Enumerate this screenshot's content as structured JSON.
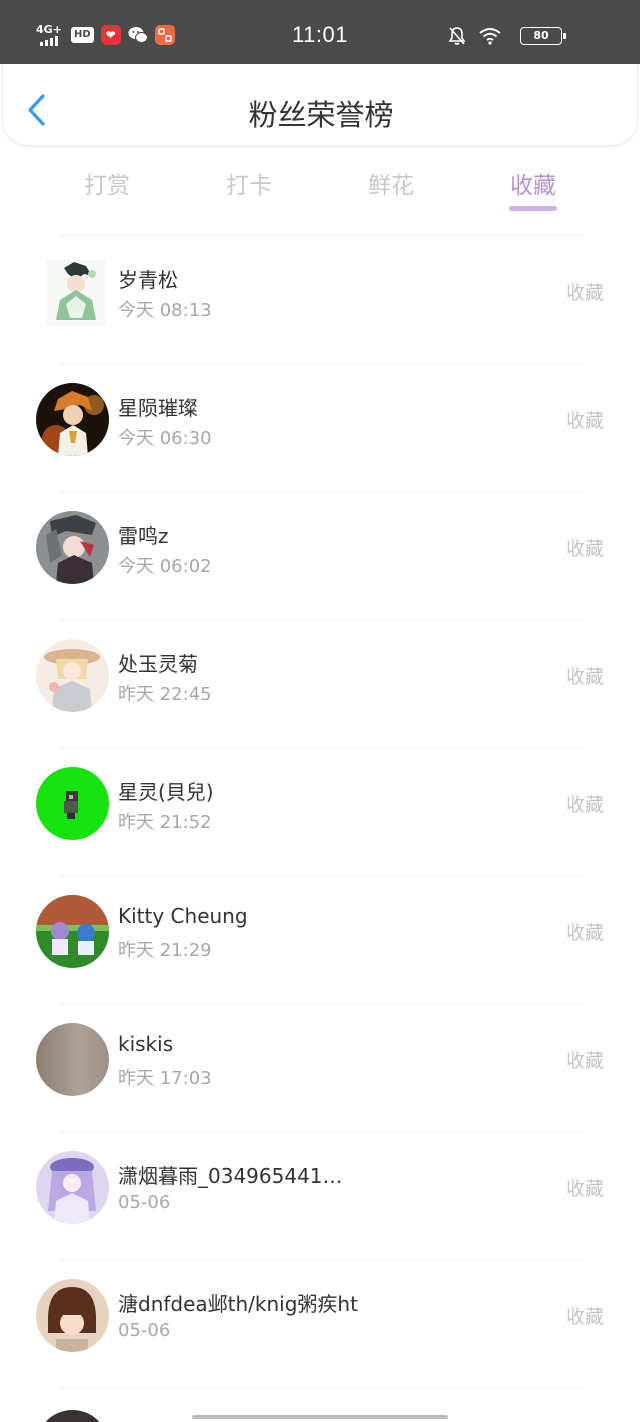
{
  "status_bar": {
    "network": "4G+",
    "hd_label": "HD",
    "time": "11:01",
    "battery": "80"
  },
  "header": {
    "title": "粉丝荣誉榜"
  },
  "tabs": [
    {
      "label": "打赏",
      "active": false
    },
    {
      "label": "打卡",
      "active": false
    },
    {
      "label": "鲜花",
      "active": false
    },
    {
      "label": "收藏",
      "active": true
    }
  ],
  "list": [
    {
      "name": "岁青松",
      "time": "今天 08:13",
      "action": "收藏"
    },
    {
      "name": "星陨璀璨",
      "time": "今天 06:30",
      "action": "收藏"
    },
    {
      "name": "雷鸣z",
      "time": "今天 06:02",
      "action": "收藏"
    },
    {
      "name": "处玉灵菊",
      "time": "昨天 22:45",
      "action": "收藏"
    },
    {
      "name": "星灵(貝兒)",
      "time": "昨天 21:52",
      "action": "收藏"
    },
    {
      "name": "Kitty Cheung",
      "time": "昨天 21:29",
      "action": "收藏"
    },
    {
      "name": "kiskis",
      "time": "昨天 17:03",
      "action": "收藏"
    },
    {
      "name": "潇烟暮雨_034965441…",
      "time": "05-06",
      "action": "收藏"
    },
    {
      "name": "溏dnfdea邺th/knig粥疾ht",
      "time": "05-06",
      "action": "收藏"
    }
  ],
  "colors": {
    "accent": "#b592d6",
    "back_icon": "#2f9cf3"
  }
}
